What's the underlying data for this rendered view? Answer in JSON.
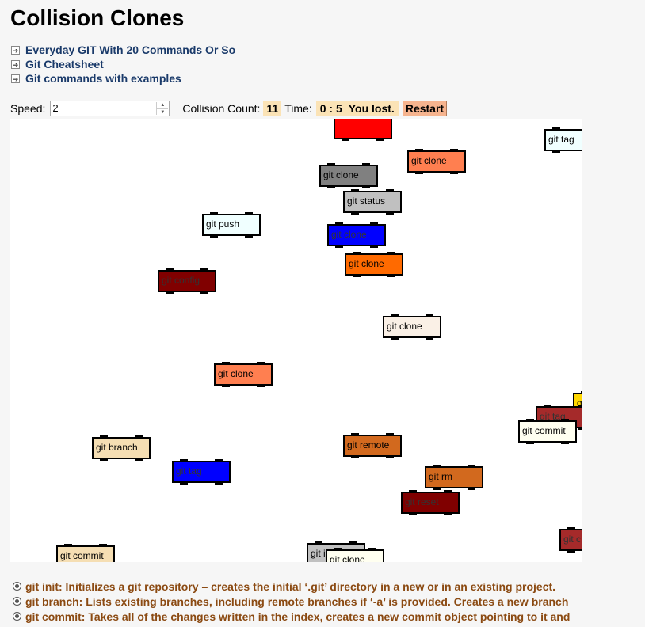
{
  "title": "Collision Clones",
  "links": [
    {
      "label": "Everyday GIT With 20 Commands Or So"
    },
    {
      "label": "Git Cheatsheet"
    },
    {
      "label": "Git commands with examples"
    }
  ],
  "controls": {
    "speed_label": "Speed:",
    "speed_value": "2",
    "collision_label": "Collision Count:",
    "collision_count": "11",
    "time_label": "Time:",
    "time_value": "0 : 5",
    "status": "You lost.",
    "restart_label": "Restart"
  },
  "cars": [
    {
      "label": "",
      "color": "#ff0000"
    },
    {
      "label": "git tag",
      "color": "#f0ffff"
    },
    {
      "label": "git clone",
      "color": "#ff7f50"
    },
    {
      "label": "git clone",
      "color": "#808080"
    },
    {
      "label": "git status",
      "color": "#c0c0c0"
    },
    {
      "label": "git push",
      "color": "#f0ffff"
    },
    {
      "label": "git clone",
      "color": "#0000ff"
    },
    {
      "label": "git clone",
      "color": "#ff6a00"
    },
    {
      "label": "git config",
      "color": "#800000"
    },
    {
      "label": "git clone",
      "color": "#faf0e6"
    },
    {
      "label": "git clone",
      "color": "#ff7f50"
    },
    {
      "label": "git",
      "color": "#ffd700"
    },
    {
      "label": "git tag",
      "color": "#a52a2a"
    },
    {
      "label": "git commit",
      "color": "#fffff0"
    },
    {
      "label": "git branch",
      "color": "#f5deb3"
    },
    {
      "label": "git remote",
      "color": "#d2691e"
    },
    {
      "label": "git tag",
      "color": "#0000ff"
    },
    {
      "label": "git rm",
      "color": "#d2691e"
    },
    {
      "label": "git reset",
      "color": "#800000"
    },
    {
      "label": "git c",
      "color": "#a52a2a"
    },
    {
      "label": "git commit",
      "color": "#f5deb3"
    },
    {
      "label": "git i",
      "color": "#c0c0c0"
    },
    {
      "label": "git clone",
      "color": "#fffff0"
    }
  ],
  "commands": [
    {
      "text": "git init: Initializes a git repository – creates the initial ‘.git’ directory in a new or in an existing project."
    },
    {
      "text": "git branch: Lists existing branches, including remote branches if ‘-a’ is provided. Creates a new branch"
    },
    {
      "text": "git commit: Takes all of the changes written in the index, creates a new commit object pointing to it and"
    }
  ]
}
